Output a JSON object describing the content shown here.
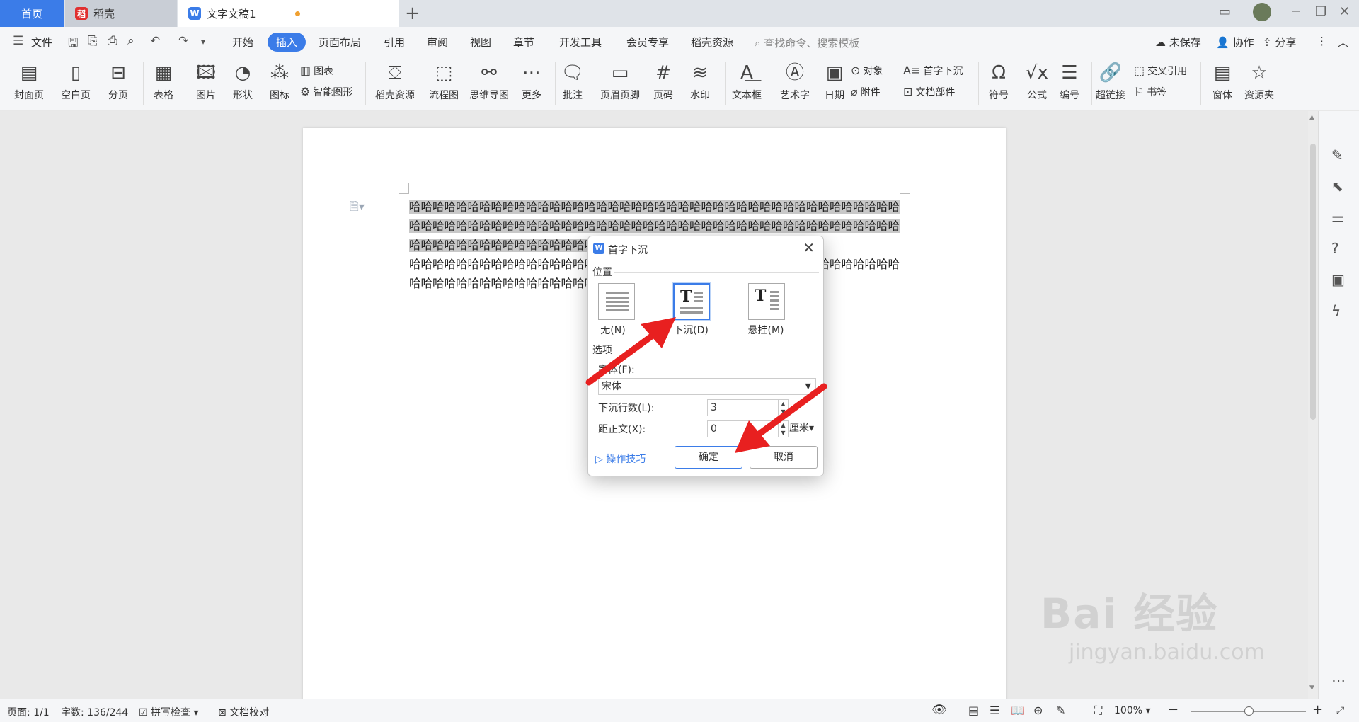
{
  "tabs": [
    {
      "label": "首页"
    },
    {
      "label": "稻壳"
    },
    {
      "label": "文字文稿1"
    }
  ],
  "menu": {
    "file": "文件",
    "items": [
      "开始",
      "插入",
      "页面布局",
      "引用",
      "审阅",
      "视图",
      "章节",
      "开发工具",
      "会员专享",
      "稻壳资源"
    ],
    "search_placeholder": "查找命令、搜索模板",
    "unsaved": "未保存",
    "collab": "协作",
    "share": "分享"
  },
  "ribbon": {
    "cover": "封面页",
    "blank": "空白页",
    "pagebreak": "分页",
    "table": "表格",
    "picture": "图片",
    "shape": "形状",
    "icon": "图标",
    "chart": "图表",
    "smart": "智能图形",
    "daoke_res": "稻壳资源",
    "flow": "流程图",
    "mindmap": "思维导图",
    "more": "更多",
    "comment": "批注",
    "header_footer": "页眉页脚",
    "page_num": "页码",
    "watermark": "水印",
    "textbox": "文本框",
    "wordart": "艺术字",
    "date": "日期",
    "object": "对象",
    "attachment": "附件",
    "dropcap": "首字下沉",
    "docpart": "文档部件",
    "symbol": "符号",
    "formula": "公式",
    "numbering": "编号",
    "hyperlink": "超链接",
    "crossref": "交叉引用",
    "bookmark": "书签",
    "window": "窗体",
    "resources": "资源夹"
  },
  "document": {
    "selected_text": "哈哈哈哈哈哈哈哈哈哈哈哈哈哈哈哈哈哈哈哈哈哈哈哈哈哈哈哈哈哈哈哈哈哈哈哈哈哈哈哈哈哈哈哈哈哈哈哈哈哈哈哈哈哈哈哈哈哈哈哈哈哈哈哈哈哈哈哈哈哈哈哈哈哈哈哈哈哈哈哈哈哈哈哈哈哈哈哈哈哈哈哈哈哈哈哈哈哈哈哈哈哈哈哈哈哈哈哈哈哈哈哈",
    "normal_text": "哈哈哈哈哈哈哈哈哈哈哈哈哈哈哈哈哈哈哈哈哈哈哈哈哈哈哈哈哈哈哈哈哈哈哈哈哈哈哈哈哈哈哈哈哈哈哈哈哈哈哈哈哈哈哈哈哈哈哈哈哈哈哈哈哈哈哈哈哈"
  },
  "dialog": {
    "title": "首字下沉",
    "position_group": "位置",
    "opt_none": "无(N)",
    "opt_drop": "下沉(D)",
    "opt_hang": "悬挂(M)",
    "options_group": "选项",
    "font_label": "字体(F):",
    "font_value": "宋体",
    "lines_label": "下沉行数(L):",
    "lines_value": "3",
    "distance_label": "距正文(X):",
    "distance_value": "0",
    "unit": "厘米",
    "tips": "操作技巧",
    "ok": "确定",
    "cancel": "取消"
  },
  "status": {
    "page": "页面: 1/1",
    "words": "字数: 136/244",
    "spell": "拼写检查",
    "proof": "文档校对",
    "zoom": "100%",
    "zoom_fraction": 0.5
  },
  "watermark": {
    "main": "Bai 经验",
    "sub": "jingyan.baidu.com"
  },
  "colors": {
    "accent": "#3b7ce8",
    "arrow": "#e82020",
    "modified_dot": "#f0a030"
  }
}
